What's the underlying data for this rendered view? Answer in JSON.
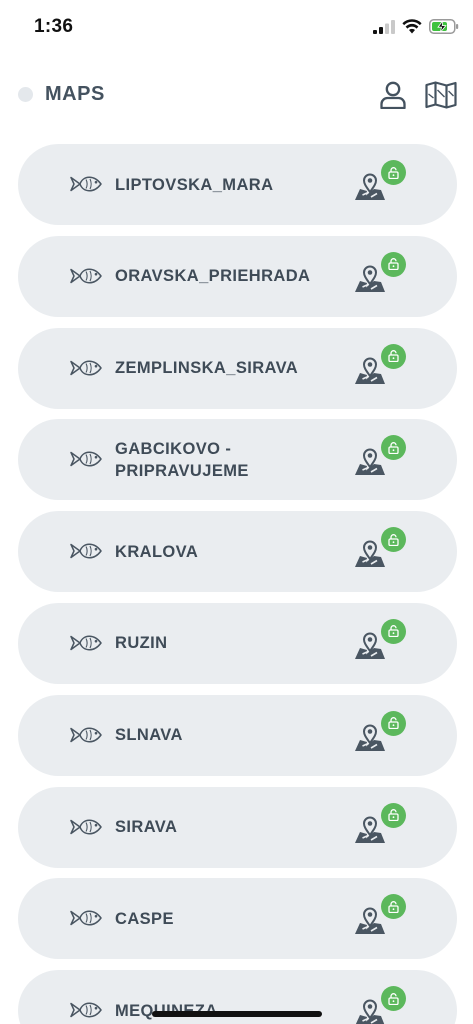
{
  "status_bar": {
    "time": "1:36"
  },
  "header": {
    "title": "MAPS"
  },
  "colors": {
    "card_bg": "#eaedf0",
    "lock_badge": "#5cb85c",
    "text": "#3f4b57"
  },
  "maps": [
    {
      "name": "LIPTOVSKA_MARA"
    },
    {
      "name": "ORAVSKA_PRIEHRADA"
    },
    {
      "name": "ZEMPLINSKA_SIRAVA"
    },
    {
      "name": "GABCIKOVO -\nPRIPRAVUJEME"
    },
    {
      "name": "KRALOVA"
    },
    {
      "name": "RUZIN"
    },
    {
      "name": "SLNAVA"
    },
    {
      "name": "SIRAVA"
    },
    {
      "name": "CASPE"
    },
    {
      "name": "MEQUINEZA"
    }
  ]
}
